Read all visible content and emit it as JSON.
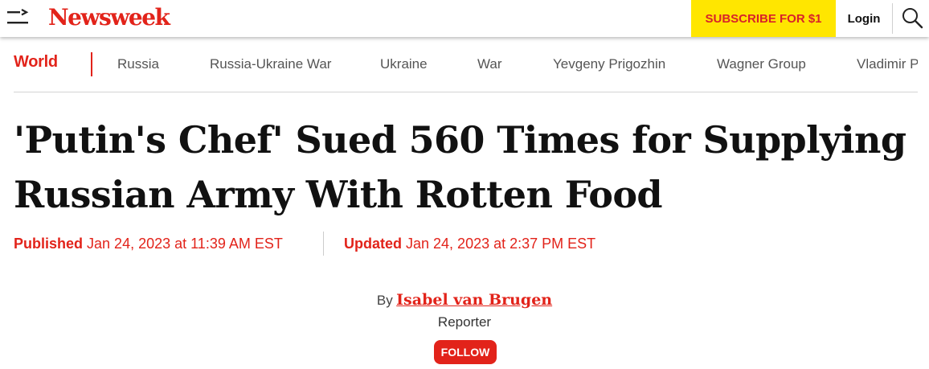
{
  "header": {
    "logo_text": "Newsweek",
    "subscribe_label": "SUBSCRIBE FOR $1",
    "login_label": "Login"
  },
  "icons": {
    "menu": "menu-icon",
    "search": "search-icon"
  },
  "colors": {
    "brand_red": "#e2231a",
    "subscribe_bg": "#ffe600",
    "text_dark": "#111111",
    "nav_gray": "#555555"
  },
  "subnav": {
    "section": "World",
    "items": [
      "Russia",
      "Russia-Ukraine War",
      "Ukraine",
      "War",
      "Yevgeny Prigozhin",
      "Wagner Group",
      "Vladimir P"
    ]
  },
  "article": {
    "headline": "'Putin's Chef' Sued 560 Times for Supplying Russian Army With Rotten Food",
    "published_label": "Published",
    "published_value": "Jan 24, 2023 at 11:39 AM EST",
    "updated_label": "Updated",
    "updated_value": "Jan 24, 2023 at 2:37 PM EST",
    "by_label": "By",
    "author": "Isabel van Brugen",
    "role": "Reporter",
    "follow_label": "FOLLOW"
  }
}
